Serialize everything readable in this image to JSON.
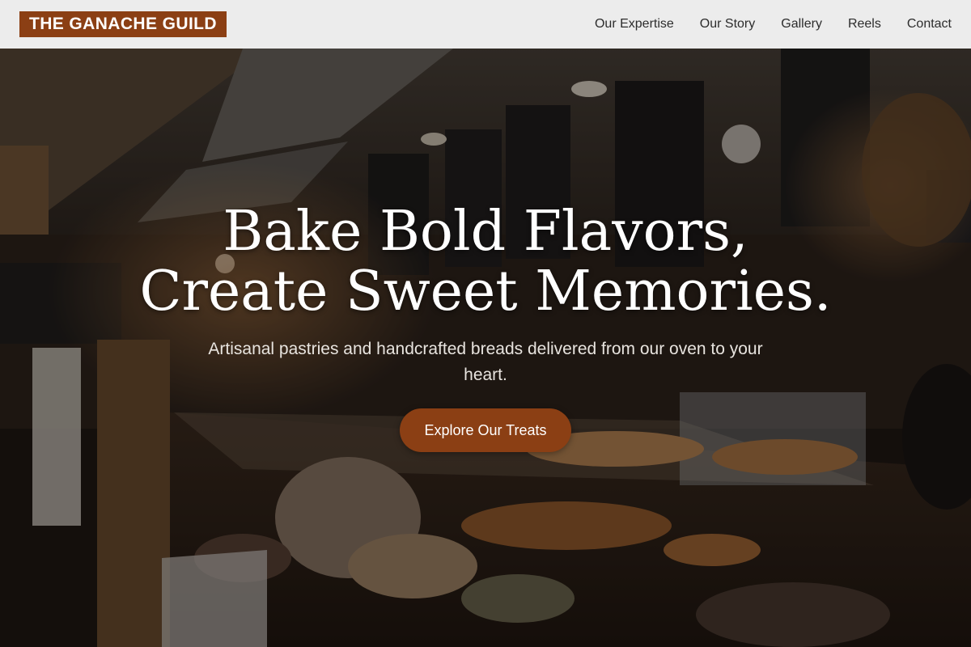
{
  "header": {
    "brand": "THE GANACHE GUILD",
    "nav": [
      {
        "label": "Our Expertise"
      },
      {
        "label": "Our Story"
      },
      {
        "label": "Gallery"
      },
      {
        "label": "Reels"
      },
      {
        "label": "Contact"
      }
    ]
  },
  "hero": {
    "headline_line1": "Bake Bold Flavors,",
    "headline_line2": "Create Sweet Memories.",
    "subline": "Artisanal pastries and handcrafted breads delivered from our oven to your heart.",
    "cta_label": "Explore Our Treats",
    "background_image": "bakery-counter-photo"
  },
  "colors": {
    "brand_accent": "#8b3f14",
    "header_bg": "#ececec",
    "nav_text": "#2c2c2c"
  }
}
